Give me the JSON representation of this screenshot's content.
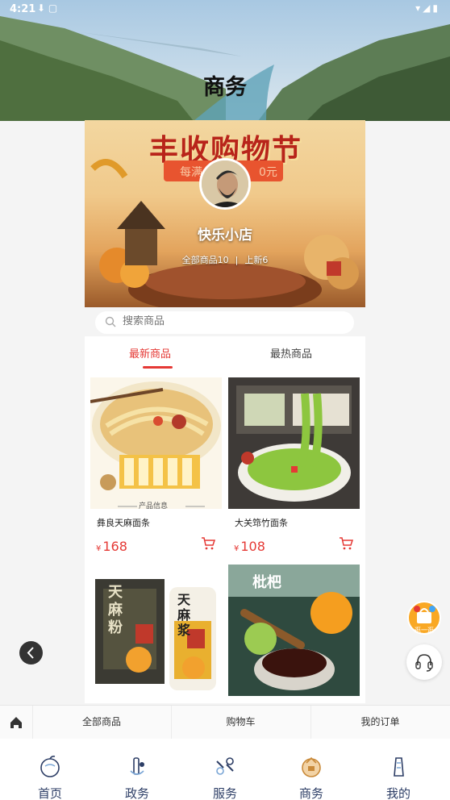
{
  "status_bar": {
    "time": "4:21",
    "left_icons": "⬇ ▢",
    "right_icons": "▾◢▮"
  },
  "header": {
    "title": "商务"
  },
  "banner": {
    "title": "丰收购物节",
    "subtitle": "每满",
    "subtitle_tail": "0元",
    "shop_name": "快乐小店",
    "all_products": "全部商品10",
    "separator": "|",
    "new_products": "上新6"
  },
  "search": {
    "placeholder": "搜索商品"
  },
  "tabs": {
    "newest": "最新商品",
    "hottest": "最热商品"
  },
  "products": [
    {
      "name": "彝良天麻面条",
      "currency": "¥",
      "price": "168",
      "img_caption": "产品信息"
    },
    {
      "name": "大关筇竹面条",
      "currency": "¥",
      "price": "108"
    },
    {
      "name": "",
      "currency": "",
      "price": "",
      "img_text": "天麻粉",
      "img_text2": "天麻浆"
    },
    {
      "name": "",
      "currency": "",
      "price": "",
      "img_text": "枇杷"
    }
  ],
  "float_shop": {
    "label": "逛一逛"
  },
  "subnav": {
    "all": "全部商品",
    "cart": "购物车",
    "orders": "我的订单"
  },
  "bottomnav": [
    {
      "label": "首页",
      "icon": "home-fruit-icon"
    },
    {
      "label": "政务",
      "icon": "government-icon"
    },
    {
      "label": "服务",
      "icon": "service-icon"
    },
    {
      "label": "商务",
      "icon": "business-icon"
    },
    {
      "label": "我的",
      "icon": "profile-icon"
    }
  ],
  "colors": {
    "accent": "#e53935",
    "nav_text": "#2d3e66"
  }
}
